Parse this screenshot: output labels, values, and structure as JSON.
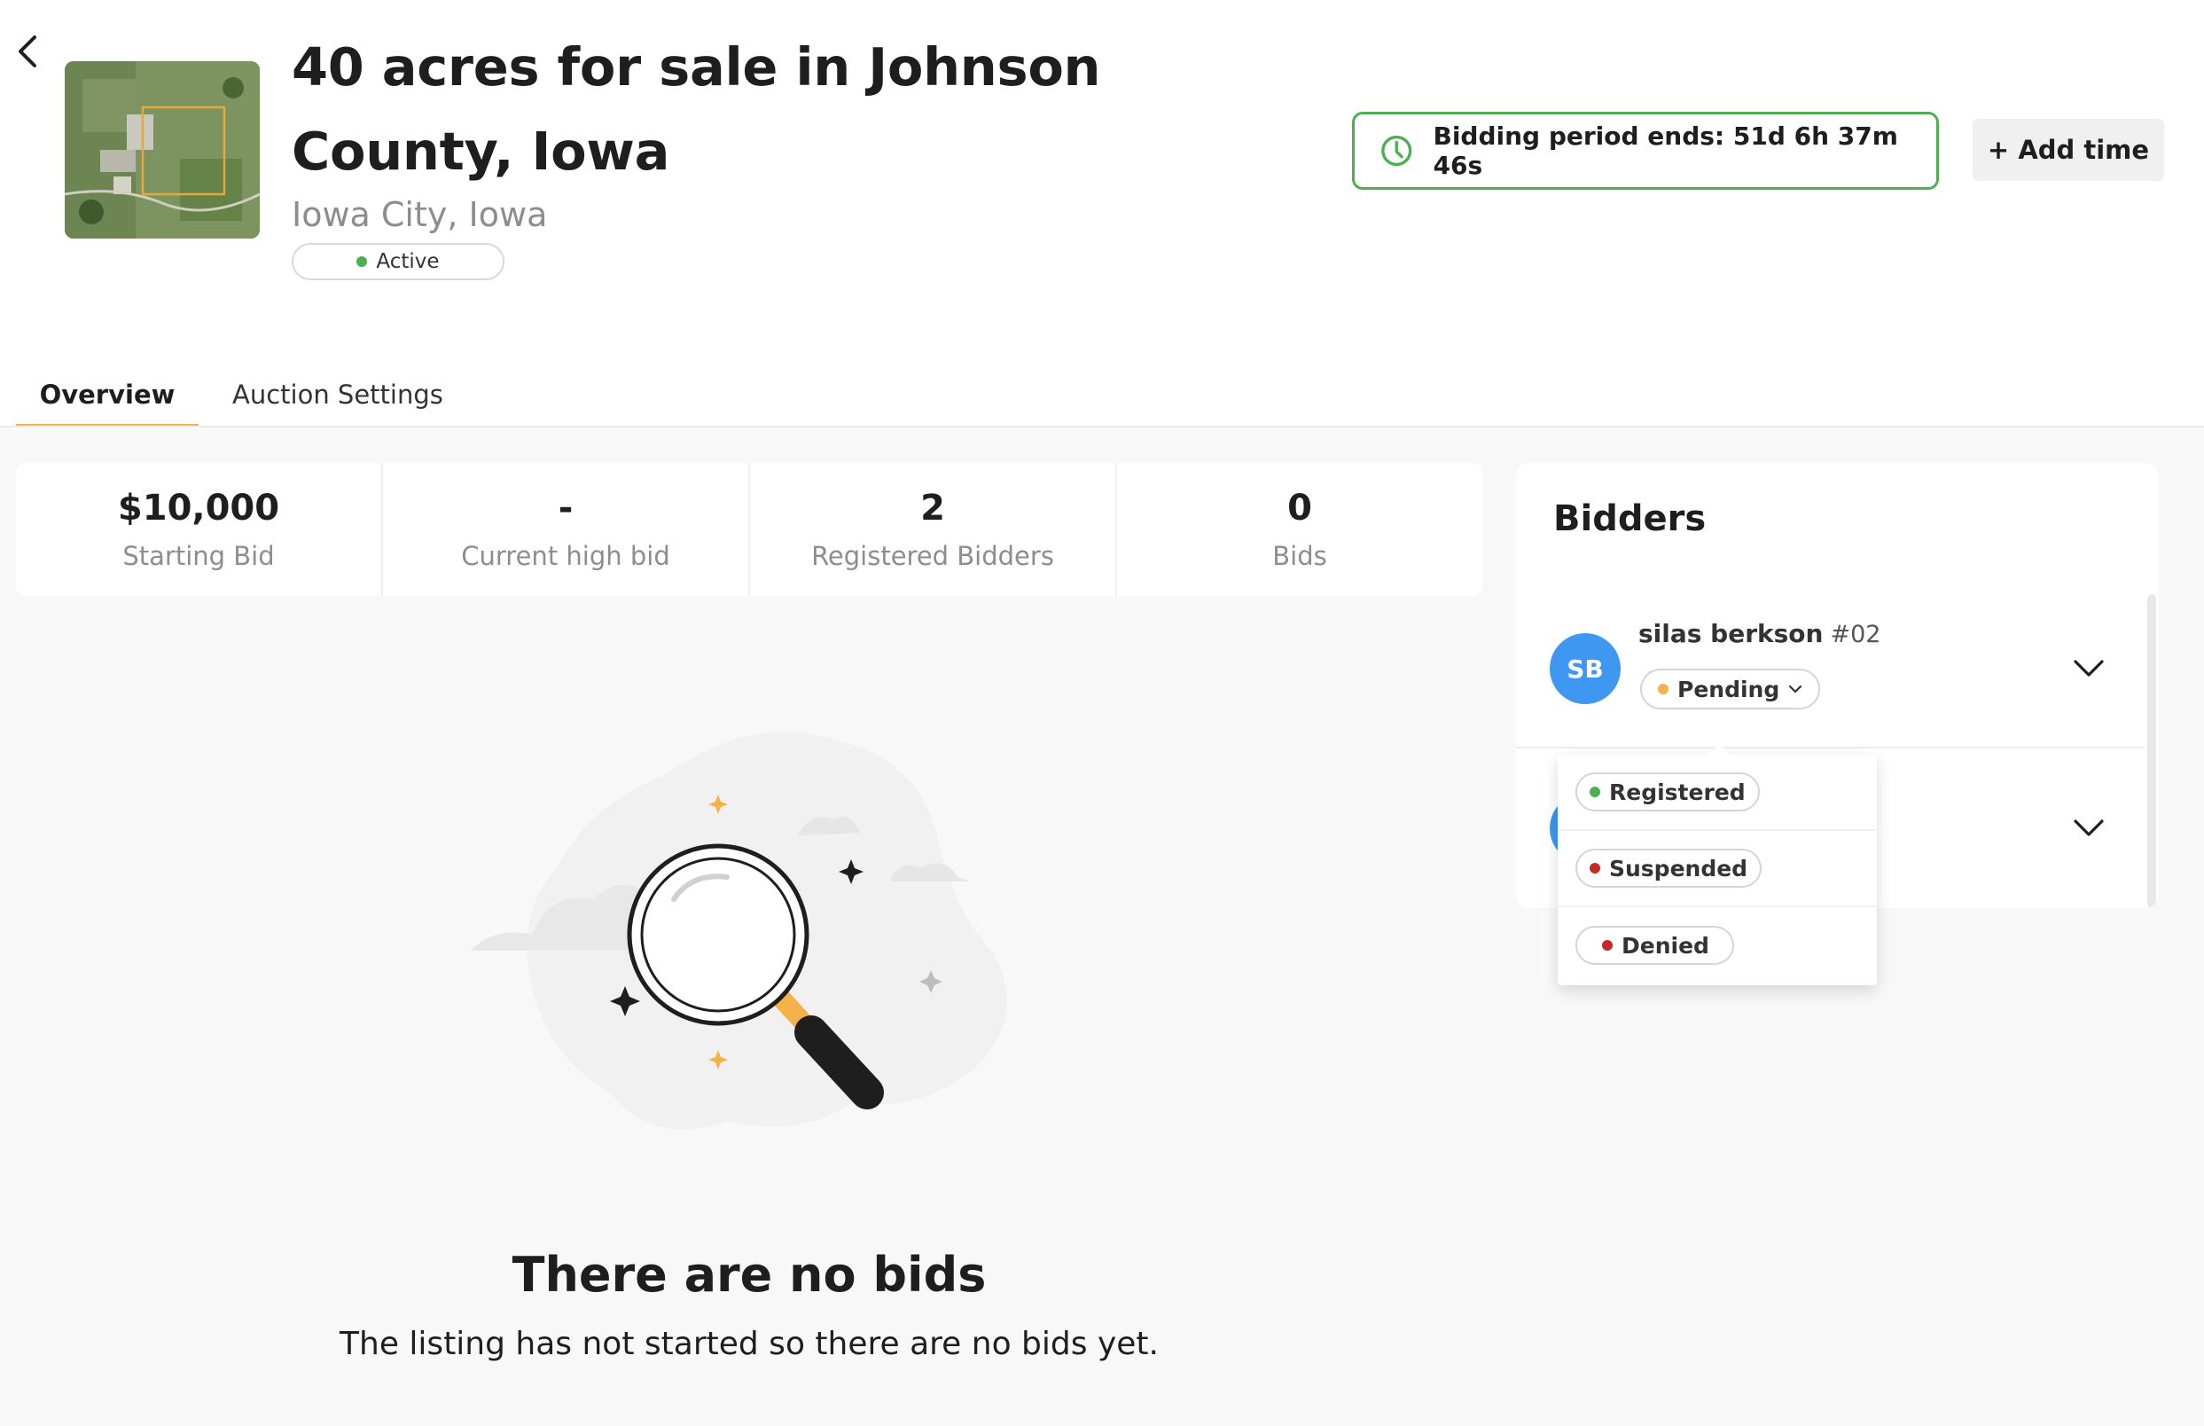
{
  "header": {
    "title": "40 acres for sale in Johnson County, Iowa",
    "location": "Iowa City, Iowa",
    "status": {
      "label": "Active",
      "color": "#4caf50"
    },
    "timer": {
      "label": "Bidding period ends: 51d 6h 37m 46s",
      "color": "#4caf50"
    },
    "add_time_label": "+ Add time"
  },
  "tabs": [
    {
      "label": "Overview",
      "active": true
    },
    {
      "label": "Auction Settings",
      "active": false
    }
  ],
  "tab_accent_color": "#f5b14a",
  "stats": [
    {
      "value": "$10,000",
      "label": "Starting Bid"
    },
    {
      "value": "-",
      "label": "Current high bid"
    },
    {
      "value": "2",
      "label": "Registered Bidders"
    },
    {
      "value": "0",
      "label": "Bids"
    }
  ],
  "empty_state": {
    "title": "There are no bids",
    "subtitle": "The listing has not started so there are no bids yet."
  },
  "bidders": {
    "title": "Bidders",
    "list": [
      {
        "initials": "SB",
        "name": "silas berkson",
        "number": "#02",
        "status": "Pending",
        "status_color": "#f5b14a"
      }
    ],
    "avatar_color": "#3e97f0"
  },
  "status_dropdown": {
    "options": [
      {
        "label": "Registered",
        "color": "#4caf50"
      },
      {
        "label": "Suspended",
        "color": "#c62828"
      },
      {
        "label": "Denied",
        "color": "#c62828"
      }
    ]
  },
  "icons": {
    "back": "chevron-left-icon",
    "clock": "clock-icon",
    "expand": "chevron-down-icon"
  }
}
